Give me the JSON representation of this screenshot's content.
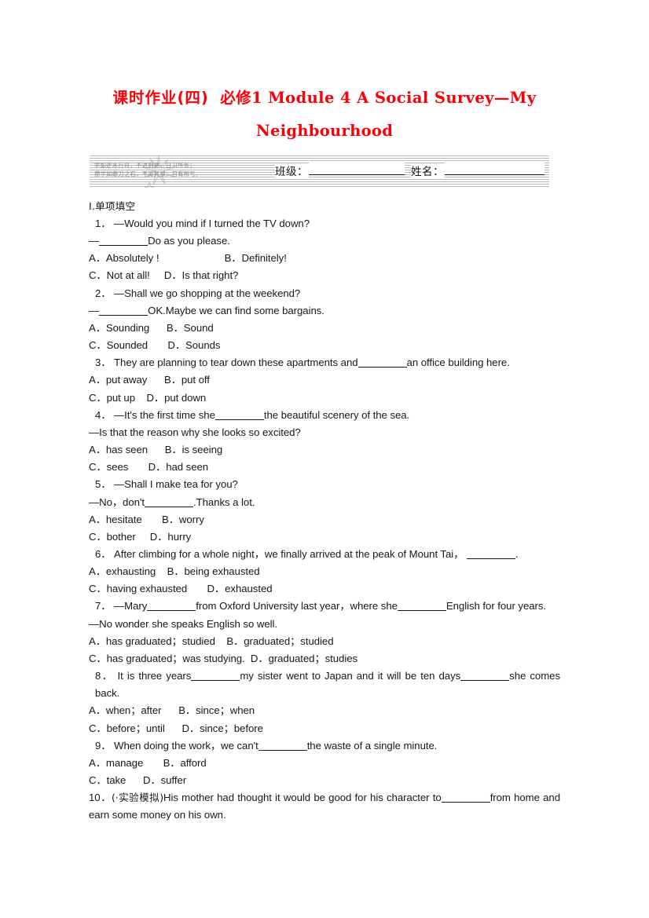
{
  "document": {
    "title_line_1_cn": "课时作业(四)",
    "title_line_1_en": "必修1 Module 4  A Social Survey—My",
    "title_line_2": "Neighbourhood",
    "title_color": "#fb0007"
  },
  "info_band": {
    "motto_line_1": "学如逆水行舟，不进则退，日习所长；",
    "motto_line_2": "攒学如磨刀之石，不见其损，日有所亏。",
    "class_label": "班级：",
    "name_label": "姓名：",
    "star_icon": "sparkle-star-icon"
  },
  "section": {
    "heading": "Ⅰ.单项填空"
  },
  "questions": [
    {
      "number": "1．",
      "stem": "—Would you mind if I turned the TV down?",
      "stem2_pre": "—",
      "stem2_post": "Do as you please.",
      "options": [
        "A．Absolutely !",
        "B．Definitely!",
        "C．Not at all!",
        "D．Is that right?"
      ]
    },
    {
      "number": "2．",
      "stem": "—Shall we go shopping at the weekend?",
      "stem2_pre": "—",
      "stem2_post": "OK.Maybe we can find some bargains.",
      "options": [
        "A．Sounding",
        "B．Sound",
        "C．Sounded",
        "D．Sounds"
      ]
    },
    {
      "number": "3．",
      "stem_pre": "They are planning to tear down these apartments and",
      "stem_post": "an office building here.",
      "options": [
        "A．put away",
        "B．put off",
        "C．put up",
        "D．put down"
      ]
    },
    {
      "number": "4．",
      "stem_pre": "—It's the first time she",
      "stem_post": "the beautiful scenery of the sea.",
      "stem2": "—Is that the reason why she looks so excited?",
      "options": [
        "A．has seen",
        "B．is seeing",
        "C．sees",
        "D．had seen"
      ]
    },
    {
      "number": "5．",
      "stem": "—Shall I make tea for you?",
      "stem2_pre": "—No，don't",
      "stem2_post": ".Thanks a lot.",
      "options": [
        "A．hesitate",
        "B．worry",
        "C．bother",
        "D．hurry"
      ]
    },
    {
      "number": "6．",
      "stem_pre": "After climbing for a whole night，we finally arrived at the peak of Mount Tai，",
      "stem_post": ".",
      "options": [
        "A．exhausting",
        "B．being exhausted",
        "C．having exhausted",
        "D．exhausted"
      ]
    },
    {
      "number": "7．",
      "stem_pre": "—Mary",
      "stem_mid": "from Oxford University last year，where she",
      "stem_post": "English for four years.",
      "stem2": "—No wonder she speaks English so well.",
      "options": [
        "A．has graduated；studied",
        "B．graduated；studied",
        "C．has graduated；was studying.",
        "D．graduated；studies"
      ]
    },
    {
      "number": "8．",
      "stem_pre": "It is three years",
      "stem_mid": "my sister went to Japan and it will be ten days",
      "stem_post": "she comes back.",
      "options": [
        "A．when；after",
        "B．since；when",
        "C．before；until",
        "D．since；before"
      ]
    },
    {
      "number": "9．",
      "stem_pre": "When doing the work，we can't",
      "stem_post": "the waste of a single minute.",
      "options": [
        "A．manage",
        "B．afford",
        "C．take",
        "D．suffer"
      ]
    },
    {
      "number": "10．",
      "tag": "(·实验模拟)",
      "stem_pre": "His mother had thought it would be good for his character to",
      "stem_post": "from home and earn some money on his own."
    }
  ]
}
